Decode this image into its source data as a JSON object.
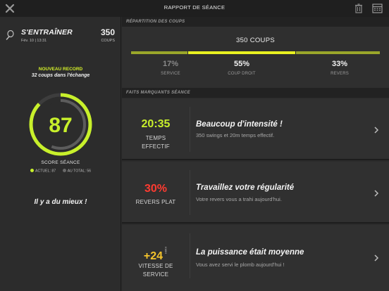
{
  "header": {
    "title": "RAPPORT DE SÉANCE"
  },
  "session": {
    "type": "S'ENTRAÎNER",
    "date": "Fév. 10 | 13:31",
    "shots_count": "350",
    "shots_label": "COUPS",
    "record_title": "NOUVEAU RECORD",
    "record_text": "32 coups dans l'échange",
    "score": "87",
    "score_label": "SCORE SÉANCE",
    "legend_current": "ACTUEL: 87",
    "legend_total": "AU TOTAL: 56",
    "verdict": "Il y a du mieux !",
    "score_value": 87,
    "total_value": 56
  },
  "distribution": {
    "section_title": "RÉPARTITION DES COUPS",
    "total": "350 COUPS",
    "items": [
      {
        "pct": "17%",
        "label": "SERVICE",
        "share": 17
      },
      {
        "pct": "55%",
        "label": "COUP DROIT",
        "share": 55
      },
      {
        "pct": "33%",
        "label": "REVERS",
        "share": 33
      }
    ]
  },
  "highlights": {
    "section_title": "FAITS MARQUANTS SÉANCE",
    "cards": [
      {
        "metric": "20:35",
        "label_line1": "TEMPS",
        "label_line2": "EFFECTIF",
        "title": "Beaucoup d'intensité !",
        "desc": "350 swings et 20m temps effectif."
      },
      {
        "metric": "30%",
        "label_line1": "REVERS PLAT",
        "label_line2": "",
        "title": "Travaillez votre régularité",
        "desc": "Votre revers vous a trahi aujourd'hui."
      },
      {
        "metric": "+24",
        "unit": "KM/H",
        "label_line1": "VITESSE DE",
        "label_line2": "SERVICE",
        "title": "La puissance était moyenne",
        "desc": "Vous avez servi le plomb aujourd'hui !"
      }
    ]
  },
  "colors": {
    "accent_green": "#c8f02b",
    "accent_red": "#ff3b30",
    "accent_yellow": "#f5c42c",
    "gauge_track": "#3d3d3d"
  }
}
